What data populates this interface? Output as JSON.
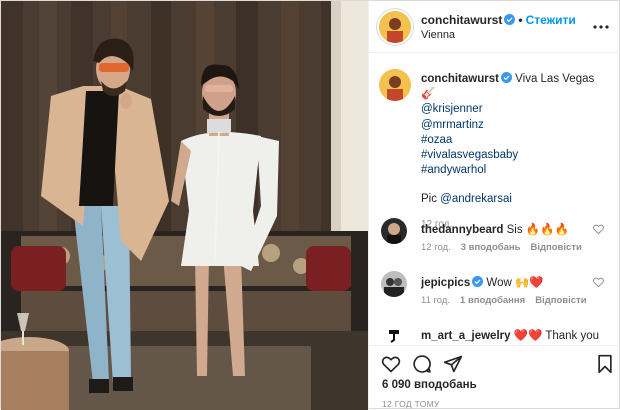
{
  "header": {
    "username": "conchitawurst",
    "follow_label": "Стежити",
    "location": "Vienna"
  },
  "caption": {
    "username": "conchitawurst",
    "text": "Viva Las Vegas 🎸",
    "links": [
      "@krisjenner",
      "@mrmartinz",
      "#ozaa",
      "#vivalasvegasbaby",
      "#andywarhol"
    ],
    "pic_prefix": "Pic ",
    "pic_link": "@andrekarsai",
    "time": "12 год."
  },
  "comments": [
    {
      "username": "thedannybeard",
      "text": "Sis 🔥🔥🔥",
      "time": "12 год.",
      "likes": "3 вподобань",
      "reply": "Відповісти"
    },
    {
      "username": "jepicpics",
      "text": "Wow 🙌❤️",
      "time": "11 год.",
      "likes": "1 вподобання",
      "reply": "Відповісти"
    },
    {
      "username": "m_art_a_jewelry",
      "text": "❤️❤️ Thank you",
      "time": "",
      "likes": "",
      "reply": ""
    }
  ],
  "likes_count": "6 090 вподобань",
  "post_time": "12 ГОД ТОМУ",
  "colors": {
    "link": "#00376b",
    "follow": "#0095f6",
    "muted": "#8e8e8e",
    "verified": "#3897f0"
  }
}
